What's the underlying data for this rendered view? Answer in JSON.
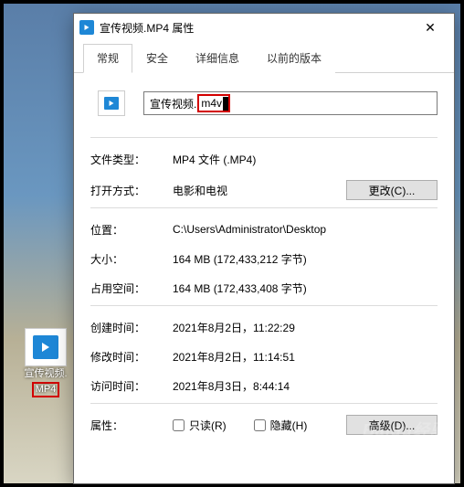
{
  "desktop": {
    "icon_label_line1": "宣传视频.",
    "icon_label_line2": "MP4"
  },
  "dialog": {
    "title": "宣传视频.MP4 属性",
    "close_icon": "✕",
    "tabs": [
      "常规",
      "安全",
      "详细信息",
      "以前的版本"
    ],
    "filename": {
      "base": "宣传视频.",
      "ext": "m4v"
    },
    "rows": {
      "filetype_k": "文件类型：",
      "filetype_v": "MP4 文件 (.MP4)",
      "openwith_k": "打开方式：",
      "openwith_v": "电影和电视",
      "change_btn": "更改(C)...",
      "location_k": "位置：",
      "location_v": "C:\\Users\\Administrator\\Desktop",
      "size_k": "大小：",
      "size_v": "164 MB (172,433,212 字节)",
      "sizeondisk_k": "占用空间：",
      "sizeondisk_v": "164 MB (172,433,408 字节)",
      "created_k": "创建时间：",
      "created_v": "2021年8月2日，11:22:29",
      "modified_k": "修改时间：",
      "modified_v": "2021年8月2日，11:14:51",
      "accessed_k": "访问时间：",
      "accessed_v": "2021年8月3日，8:44:14",
      "attrs_k": "属性：",
      "readonly": "只读(R)",
      "hidden": "隐藏(H)",
      "advanced_btn": "高级(D)..."
    }
  },
  "watermark": "Baidu经验"
}
